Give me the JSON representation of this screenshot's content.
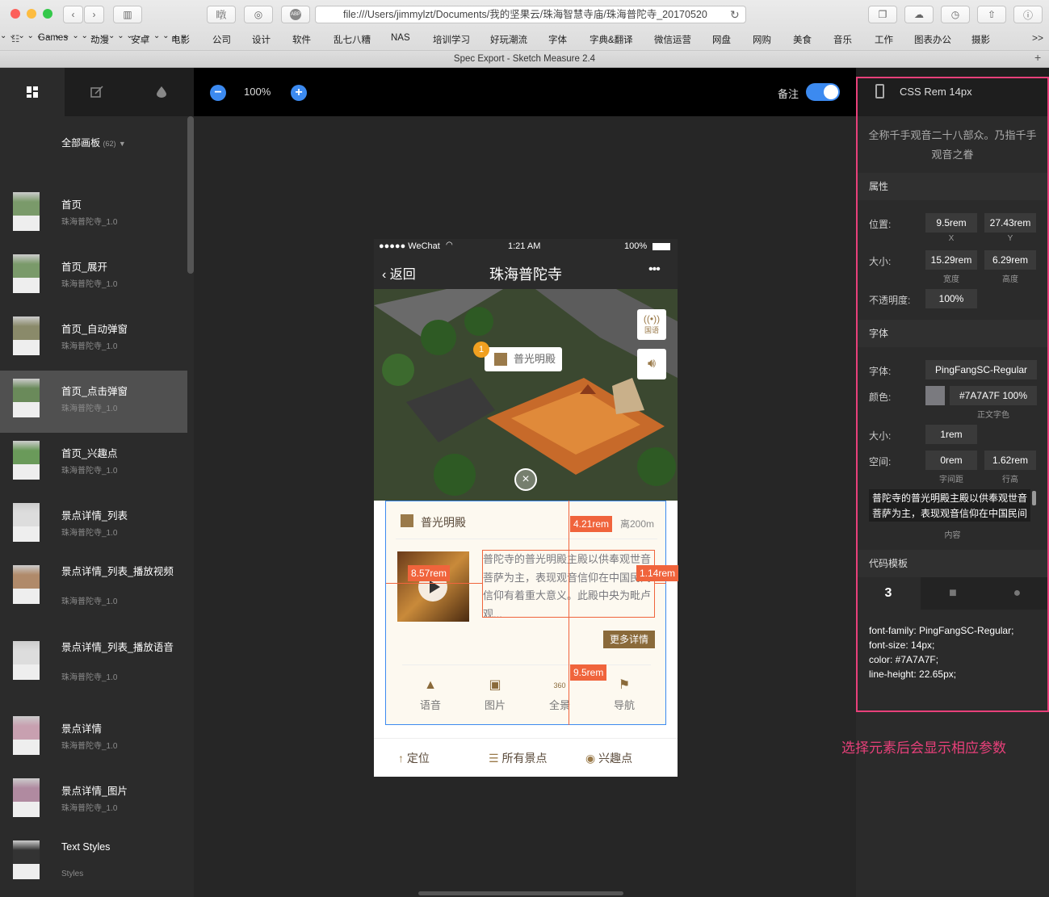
{
  "browser": {
    "url": "file:///Users/jimmylzt/Documents/我的坚果云/珠海智慧寺庙/珠海普陀寺_20170520",
    "tab_title": "Spec Export - Sketch Measure 2.4",
    "toolbar_left_text": "𥋆",
    "bookmarks": [
      "Games",
      "动漫",
      "安卓",
      "电影",
      "公司",
      "设计",
      "软件",
      "乱七八糟",
      "NAS",
      "培训学习",
      "好玩潮流",
      "字体",
      "字典&翻译",
      "微信运营",
      "网盘",
      "网购",
      "美食",
      "音乐",
      "工作",
      "图表办公",
      "摄影"
    ],
    "more": ">>"
  },
  "sidebar": {
    "header": "全部画板",
    "count": "(62)",
    "items": [
      {
        "title": "首页",
        "sub": "珠海普陀寺_1.0"
      },
      {
        "title": "首页_展开",
        "sub": "珠海普陀寺_1.0"
      },
      {
        "title": "首页_自动弹窗",
        "sub": "珠海普陀寺_1.0"
      },
      {
        "title": "首页_点击弹窗",
        "sub": "珠海普陀寺_1.0"
      },
      {
        "title": "首页_兴趣点",
        "sub": "珠海普陀寺_1.0"
      },
      {
        "title": "景点详情_列表",
        "sub": "珠海普陀寺_1.0"
      },
      {
        "title": "景点详情_列表_播放视频",
        "sub": "珠海普陀寺_1.0"
      },
      {
        "title": "景点详情_列表_播放语音",
        "sub": "珠海普陀寺_1.0"
      },
      {
        "title": "景点详情",
        "sub": "珠海普陀寺_1.0"
      },
      {
        "title": "景点详情_图片",
        "sub": "珠海普陀寺_1.0"
      },
      {
        "title": "Text Styles",
        "sub": "Styles"
      }
    ]
  },
  "toolbar": {
    "zoom": "100%",
    "note_label": "备注"
  },
  "phone": {
    "status_left": "●●●●● WeChat",
    "status_time": "1:21 AM",
    "status_right": "100%",
    "back": "返回",
    "title": "珠海普陀寺",
    "more": "•••",
    "map_pin": "普光明殿",
    "pin_number": "1",
    "side_btn_1": "国语",
    "card": {
      "title": "普光明殿",
      "distance": "离200m",
      "text": "普陀寺的普光明殿主殿以供奉观世音菩萨为主，表现观音信仰在中国民间信仰有着重大意义。此殿中央为毗卢观...",
      "more_btn": "更多详情",
      "actions": [
        "语音",
        "图片",
        "全景",
        "导航"
      ]
    },
    "bottom": [
      "定位",
      "所有景点",
      "兴趣点"
    ]
  },
  "measures": {
    "m1": "4.21rem",
    "m2": "8.57rem",
    "m3": "1.14rem",
    "m4": "9.5rem"
  },
  "panel": {
    "header": "CSS Rem 14px",
    "desc": "全称千手观音二十八部众。乃指千手观音之眷",
    "props_title": "属性",
    "position_label": "位置:",
    "x": "9.5rem",
    "x_cap": "X",
    "y": "27.43rem",
    "y_cap": "Y",
    "size_label": "大小:",
    "w": "15.29rem",
    "w_cap": "宽度",
    "h": "6.29rem",
    "h_cap": "高度",
    "opacity_label": "不透明度:",
    "opacity": "100%",
    "font_title": "字体",
    "font_label": "字体:",
    "font": "PingFangSC-Regular",
    "color_label": "颜色:",
    "color": "#7A7A7F 100%",
    "color_cap": "正文字色",
    "color_swatch": "#7A7A7F",
    "fsize_label": "大小:",
    "fsize": "1rem",
    "space_label": "空间:",
    "ls": "0rem",
    "ls_cap": "字间距",
    "lh": "1.62rem",
    "lh_cap": "行高",
    "content": "普陀寺的普光明殿主殿以供奉观世音菩萨为主，表现观音信仰在中国民间",
    "content_cap": "内容",
    "code_title": "代码模板",
    "code": [
      "font-family: PingFangSC-Regular;",
      "font-size: 14px;",
      "color: #7A7A7F;",
      "line-height: 22.65px;"
    ]
  },
  "annotation": "选择元素后会显示相应参数"
}
